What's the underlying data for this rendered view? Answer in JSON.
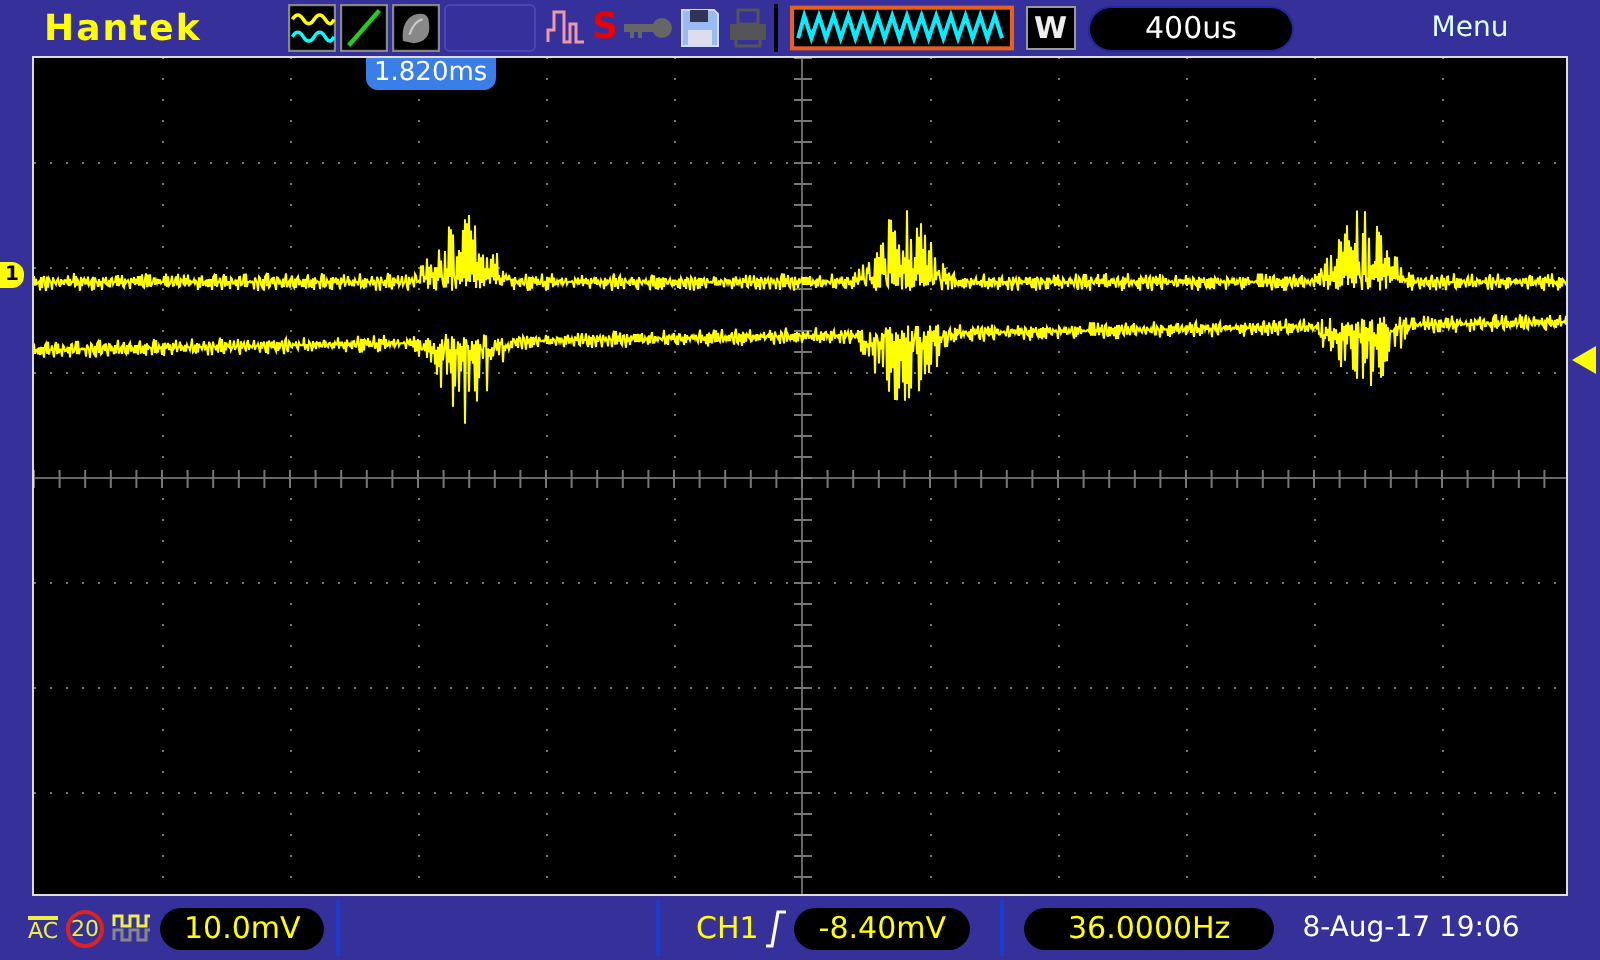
{
  "brand": "Hantek",
  "toolbar": {
    "status_letter": "S"
  },
  "cursor_time": "1.820ms",
  "timebase": {
    "mode": "W",
    "value": "400us"
  },
  "menu": "Menu",
  "channel_marker": "1",
  "channel": {
    "coupling": "AC",
    "bandwidth_limit": "20",
    "scale": "10.0mV"
  },
  "trigger": {
    "source": "CH1",
    "level": "-8.40mV"
  },
  "frequency": "36.0000Hz",
  "datetime": "8-Aug-17 19:06"
}
